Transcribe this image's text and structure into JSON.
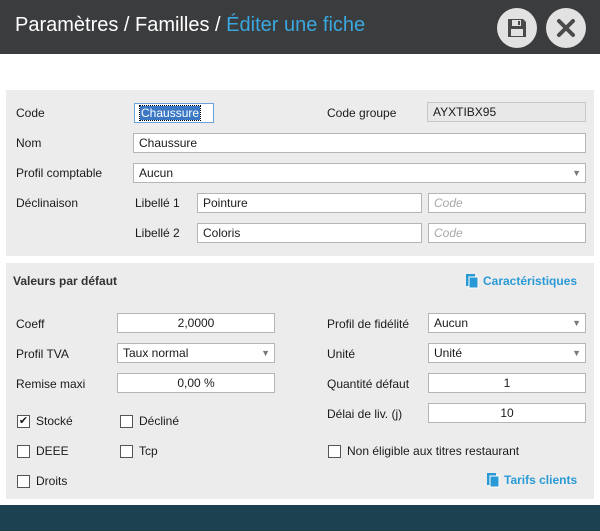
{
  "header": {
    "crumb1": "Paramètres",
    "sep1": " / ",
    "crumb2": "Familles",
    "sep2": " / ",
    "crumb3": "Éditer une fiche",
    "save_icon": "floppy-disk-icon",
    "close_icon": "close-x-icon"
  },
  "form": {
    "code_label": "Code",
    "code_value": "Chaussure",
    "code_groupe_label": "Code groupe",
    "code_groupe_value": "AYXTIBX95",
    "nom_label": "Nom",
    "nom_value": "Chaussure",
    "profil_comptable_label": "Profil comptable",
    "profil_comptable_value": "Aucun",
    "declinaison_label": "Déclinaison",
    "libelle1_label": "Libellé 1",
    "libelle1_value": "Pointure",
    "libelle1_code_placeholder": "Code",
    "libelle2_label": "Libellé 2",
    "libelle2_value": "Coloris",
    "libelle2_code_placeholder": "Code"
  },
  "defaults": {
    "title": "Valeurs par défaut",
    "caracteristiques_link": "Caractéristiques",
    "coeff_label": "Coeff",
    "coeff_value": "2,0000",
    "profil_tva_label": "Profil TVA",
    "profil_tva_value": "Taux normal",
    "remise_label": "Remise maxi",
    "remise_value": "0,00 %",
    "profil_fidelite_label": "Profil de fidélité",
    "profil_fidelite_value": "Aucun",
    "unite_label": "Unité",
    "unite_value": "Unité",
    "quantite_label": "Quantité défaut",
    "quantite_value": "1",
    "delai_label": "Délai de liv. (j)",
    "delai_value": "10",
    "stocke_label": "Stocké",
    "stocke_checked": true,
    "decline_label": "Décliné",
    "decline_checked": false,
    "deee_label": "DEEE",
    "deee_checked": false,
    "tcp_label": "Tcp",
    "tcp_checked": false,
    "droits_label": "Droits",
    "droits_checked": false,
    "non_eligible_label": "Non éligible aux titres restaurant",
    "non_eligible_checked": false,
    "tarifs_link": "Tarifs clients",
    "check_mark": "✔"
  },
  "colors": {
    "title_bar": "#3b3c3e",
    "accent": "#3aa8df",
    "footer": "#1c4150",
    "panel": "#ececec"
  }
}
